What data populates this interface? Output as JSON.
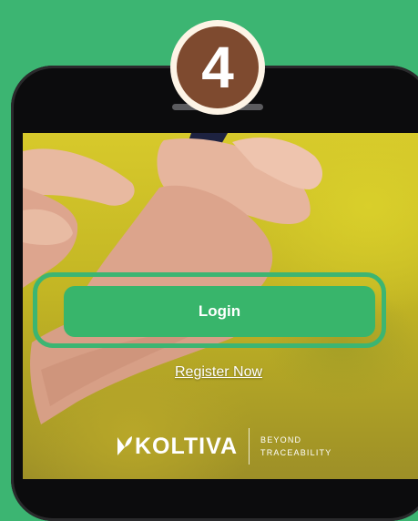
{
  "step": {
    "number": "4"
  },
  "app": {
    "login_label": "Login",
    "register_label": "Register Now",
    "brand": {
      "name": "KOLTIVA",
      "tagline_line1": "BEYOND",
      "tagline_line2": "TRACEABILITY"
    }
  },
  "colors": {
    "background": "#3cb572",
    "accent": "#38b56b",
    "badge_fill": "#7e4a2f",
    "badge_ring": "#fdf4e6"
  }
}
